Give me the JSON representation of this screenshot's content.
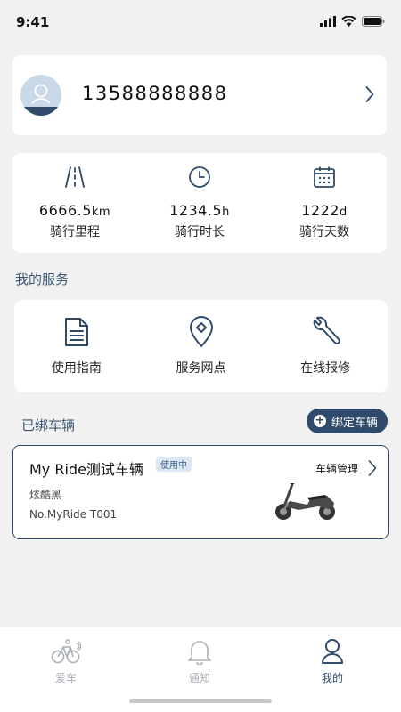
{
  "status_bar": {
    "time": "9:41"
  },
  "profile": {
    "phone": "13588888888"
  },
  "stats": [
    {
      "value": "6666.5",
      "unit": "km",
      "label": "骑行里程",
      "icon": "road-icon"
    },
    {
      "value": "1234.5",
      "unit": "h",
      "label": "骑行时长",
      "icon": "clock-icon"
    },
    {
      "value": "1222",
      "unit": "d",
      "label": "骑行天数",
      "icon": "calendar-icon"
    }
  ],
  "services": {
    "title": "我的服务",
    "items": [
      {
        "label": "使用指南",
        "icon": "document-icon"
      },
      {
        "label": "服务网点",
        "icon": "location-icon"
      },
      {
        "label": "在线报修",
        "icon": "wrench-icon"
      }
    ]
  },
  "vehicles": {
    "title": "已绑车辆",
    "bind_label": "绑定车辆",
    "items": [
      {
        "name": "My Ride测试车辆",
        "badge": "使用中",
        "color": "炫酷黑",
        "number": "No.MyRide T001",
        "manage_label": "车辆管理"
      }
    ]
  },
  "tabs": [
    {
      "label": "爱车",
      "icon": "bicycle-icon",
      "active": false
    },
    {
      "label": "通知",
      "icon": "bell-icon",
      "active": false
    },
    {
      "label": "我的",
      "icon": "user-icon",
      "active": true
    }
  ],
  "colors": {
    "accent": "#2f4a6a",
    "background": "#f1f1f1",
    "inactive": "#aab0b7"
  }
}
